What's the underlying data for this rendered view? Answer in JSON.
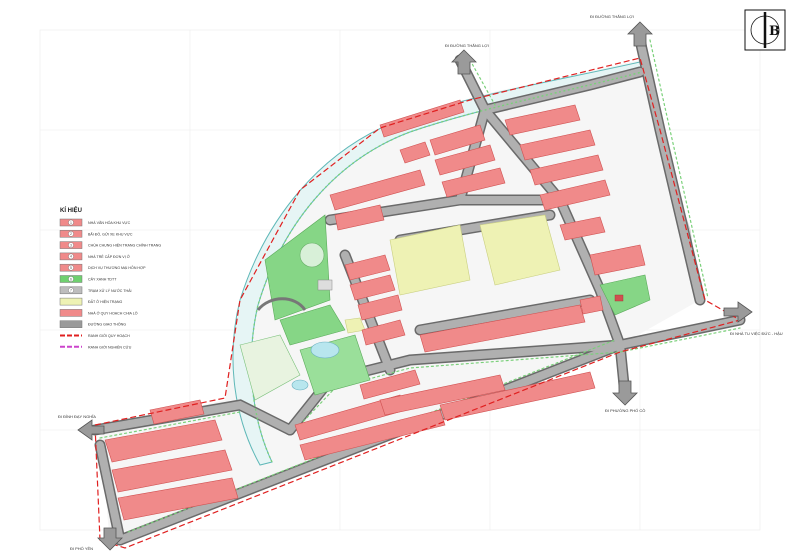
{
  "legend": {
    "title": "KÍ HIỆU",
    "items": [
      {
        "symbol": "1",
        "label": "NHÀ VĂN HÓA KHU VỰC",
        "color": "#f08a8a"
      },
      {
        "symbol": "2",
        "label": "BÃI ĐỖ, GỬI XE KHU VỰC",
        "color": "#f08a8a"
      },
      {
        "symbol": "3",
        "label": "CHÙA CHUNG HIỆN TRẠNG CHỈNH TRANG",
        "color": "#f08a8a"
      },
      {
        "symbol": "4",
        "label": "NHÀ TRẺ CẤP ĐƠN VỊ Ở",
        "color": "#f08a8a"
      },
      {
        "symbol": "5",
        "label": "DỊCH VỤ THƯƠNG MẠI HỖN HỢP",
        "color": "#f08a8a"
      },
      {
        "symbol": "6",
        "label": "CÂY XANH TDTT",
        "color": "#6fd06f"
      },
      {
        "symbol": "7",
        "label": "TRẠM XỬ LÝ NƯỚC THẢI",
        "color": "#bdbdbd"
      },
      {
        "symbol": "",
        "label": "ĐẤT Ở HIỆN TRẠNG",
        "color": "#eef2b4"
      },
      {
        "symbol": "",
        "label": "NHÀ Ở QUY HOẠCH CHIA LÔ",
        "color": "#f08a8a"
      },
      {
        "symbol": "",
        "label": "ĐƯỜNG GIAO THÔNG",
        "color": "#9a9a9a"
      },
      {
        "symbol": "",
        "label": "RANH GIỚI QUY HOẠCH",
        "color": "#e02020"
      },
      {
        "symbol": "",
        "label": "RANH GIỚI NGHIÊN CỨU",
        "color": "#cc44cc"
      }
    ]
  },
  "road_labels": {
    "north_east": "ĐI ĐƯỜNG THĂNG LỢI",
    "north": "ĐI ĐƯỜNG THĂNG LỢI",
    "east": "ĐI NHÀ TU VIỆC ĐỨC - HẬU",
    "south_east": "ĐI PHƯỜNG PHỐ CÒ",
    "west": "ĐI ĐÌNH ĐẠY NGHĨA",
    "south_west": "ĐI PHỐ YÊN"
  },
  "compass": {
    "letter": "B"
  },
  "colors": {
    "lot": "#f08a8a",
    "lot_edge": "#d05050",
    "road": "#a8a8a8",
    "road_edge": "#6a6a6a",
    "tree_line": "#7ad07a",
    "canal": "#e8f6f6",
    "green": "#86d686",
    "existing": "#eef2b4",
    "boundary": "#e02020"
  }
}
